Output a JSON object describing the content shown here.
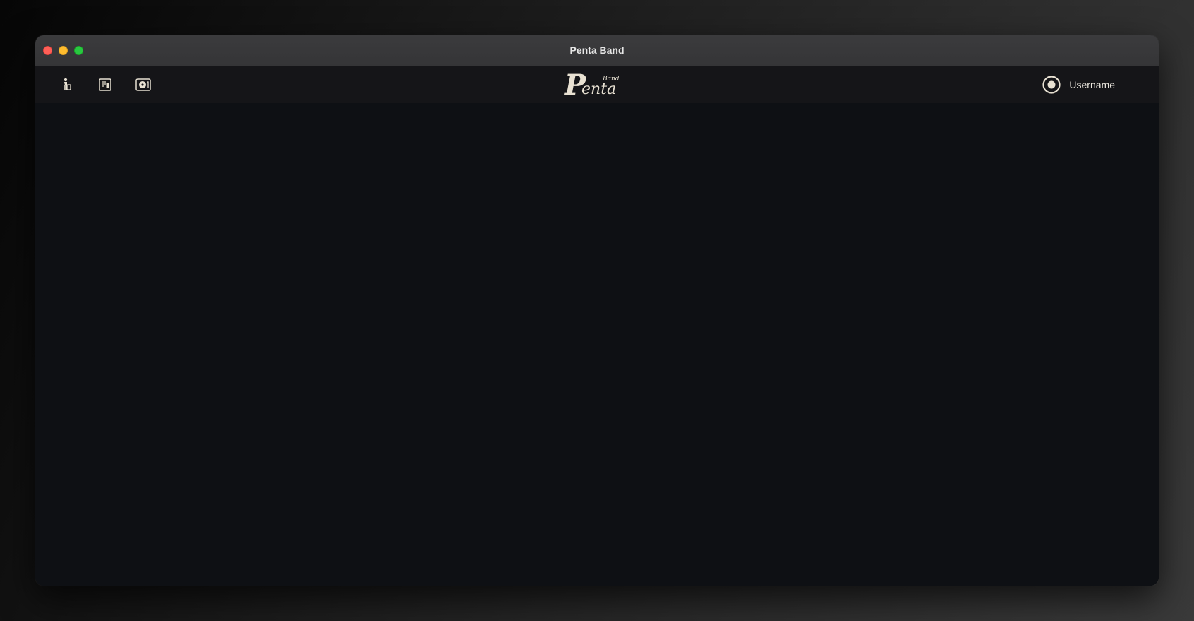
{
  "window": {
    "title": "Penta Band"
  },
  "toolbar": {
    "icons": [
      {
        "name": "musician-icon"
      },
      {
        "name": "score-icon"
      },
      {
        "name": "media-player-icon"
      }
    ],
    "logo_text": "Penta",
    "logo_subtext": "Band"
  },
  "user": {
    "name": "Username",
    "icon": "user-circle-icon"
  },
  "colors": {
    "icon_color": "#e8e1d2",
    "toolbar_bg": "#151518",
    "content_bg": "#0e1014",
    "titlebar_bg": "#3b3b3d"
  }
}
